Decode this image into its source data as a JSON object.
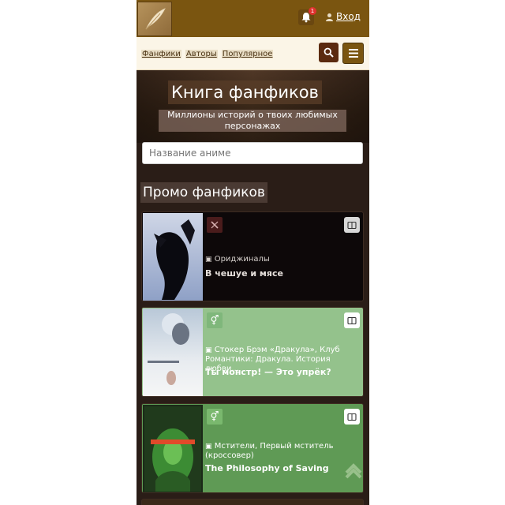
{
  "header": {
    "login_label": "Вход",
    "notification_count": "1"
  },
  "nav": {
    "links": [
      "Фанфики",
      "Авторы",
      "Популярное"
    ]
  },
  "hero": {
    "title": "Книга фанфиков",
    "subtitle": "Миллионы историй о твоих любимых персонажах"
  },
  "search": {
    "placeholder": "Название аниме"
  },
  "promo": {
    "section_title": "Промо фанфиков",
    "cards": [
      {
        "fandom": "Ориджиналы",
        "title": "В чешуе и мясе",
        "direction_icon": "crossed-swords-icon",
        "color": "#0d0809"
      },
      {
        "fandom": "Стокер Брэм «Дракула», Клуб Романтики: Дракула. История любви...",
        "title": "Ты монстр! — Это упрёк?",
        "direction_icon": "gender-mixed-icon",
        "color": "#94c28c"
      },
      {
        "fandom": "Мстители, Первый мститель (кроссовер)",
        "title": "The Philosophy of Saving",
        "direction_icon": "gender-mixed-icon",
        "color": "#5f9a55"
      }
    ]
  },
  "colors": {
    "header_bg": "#7a5510",
    "nav_bg": "#fbf5e7",
    "page_bg": "#2a1d17"
  }
}
